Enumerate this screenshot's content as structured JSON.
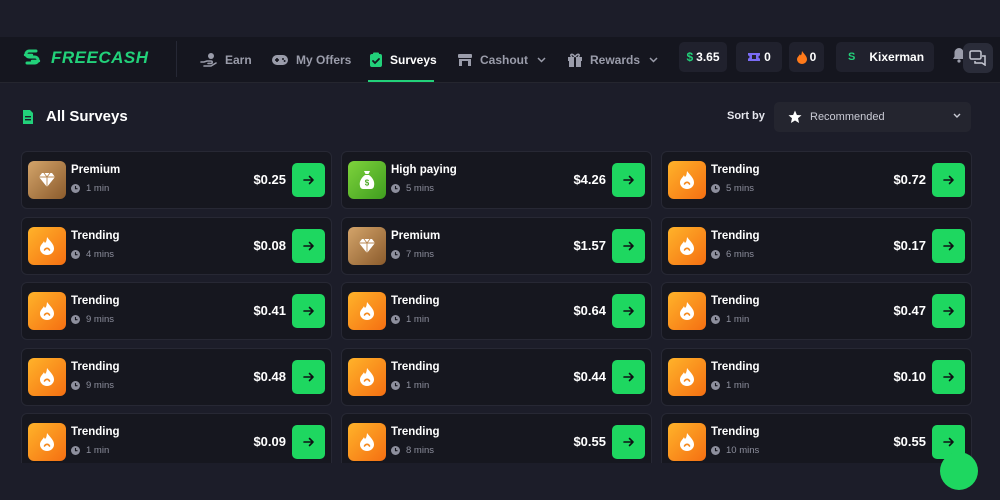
{
  "brand": {
    "name": "FREECASH",
    "accent": "#22d17a"
  },
  "nav": {
    "items": [
      {
        "label": "Earn",
        "icon": "hand-coin-icon"
      },
      {
        "label": "My Offers",
        "icon": "gamepad-icon"
      },
      {
        "label": "Surveys",
        "icon": "clipboard-check-icon",
        "active": true
      },
      {
        "label": "Cashout",
        "icon": "store-icon",
        "dropdown": true
      },
      {
        "label": "Rewards",
        "icon": "gift-icon",
        "dropdown": true
      }
    ],
    "balance": "3.65",
    "balance_symbol": "$",
    "tickets": "0",
    "streak": "0",
    "user_initial": "S",
    "username": "Kixerman"
  },
  "page": {
    "title": "All Surveys",
    "sort_label": "Sort by",
    "sort_value": "Recommended"
  },
  "surveys": [
    {
      "title": "Premium",
      "duration": "1 min",
      "price": "$0.25",
      "type": "premium"
    },
    {
      "title": "High paying",
      "duration": "5 mins",
      "price": "$4.26",
      "type": "high"
    },
    {
      "title": "Trending",
      "duration": "5 mins",
      "price": "$0.72",
      "type": "trending"
    },
    {
      "title": "Trending",
      "duration": "4 mins",
      "price": "$0.08",
      "type": "trending"
    },
    {
      "title": "Premium",
      "duration": "7 mins",
      "price": "$1.57",
      "type": "premium"
    },
    {
      "title": "Trending",
      "duration": "6 mins",
      "price": "$0.17",
      "type": "trending"
    },
    {
      "title": "Trending",
      "duration": "9 mins",
      "price": "$0.41",
      "type": "trending"
    },
    {
      "title": "Trending",
      "duration": "1 min",
      "price": "$0.64",
      "type": "trending"
    },
    {
      "title": "Trending",
      "duration": "1 min",
      "price": "$0.47",
      "type": "trending"
    },
    {
      "title": "Trending",
      "duration": "9 mins",
      "price": "$0.48",
      "type": "trending"
    },
    {
      "title": "Trending",
      "duration": "1 min",
      "price": "$0.44",
      "type": "trending"
    },
    {
      "title": "Trending",
      "duration": "1 min",
      "price": "$0.10",
      "type": "trending"
    },
    {
      "title": "Trending",
      "duration": "1 min",
      "price": "$0.09",
      "type": "trending"
    },
    {
      "title": "Trending",
      "duration": "8 mins",
      "price": "$0.55",
      "type": "trending"
    },
    {
      "title": "Trending",
      "duration": "10 mins",
      "price": "$0.55",
      "type": "trending"
    }
  ]
}
